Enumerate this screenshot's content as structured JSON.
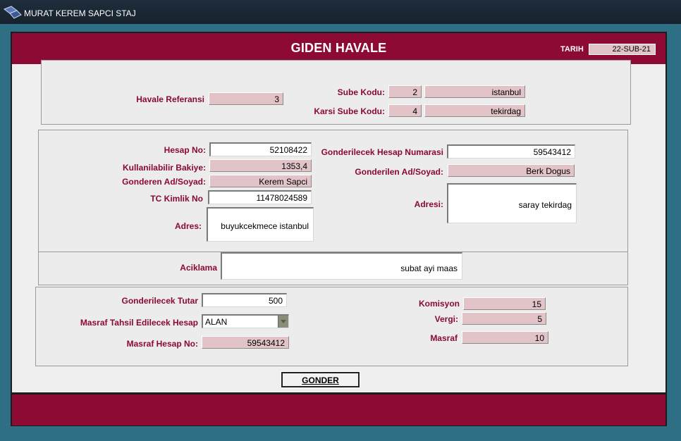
{
  "window": {
    "title": "MURAT KEREM SAPCI STAJ"
  },
  "header": {
    "title": "GIDEN HAVALE",
    "date_label": "TARIH",
    "date_value": "22-SUB-21"
  },
  "reference": {
    "havale_referansi_label": "Havale Referansi",
    "havale_referansi_value": "3",
    "sube_kodu_label": "Sube Kodu:",
    "sube_kodu_value": "2",
    "sube_adi_value": "istanbul",
    "karsi_sube_kodu_label": "Karsi Sube Kodu:",
    "karsi_sube_kodu_value": "4",
    "karsi_sube_adi_value": "tekirdag"
  },
  "sender": {
    "hesap_no_label": "Hesap No:",
    "hesap_no_value": "52108422",
    "bakiye_label": "Kullanilabilir Bakiye:",
    "bakiye_value": "1353,4",
    "ad_soyad_label": "Gonderen Ad/Soyad:",
    "ad_soyad_value": "Kerem Sapci",
    "tc_label": "TC Kimlik No",
    "tc_value": "11478024589",
    "adres_label": "Adres:",
    "adres_value": "buyukcekmece istanbul"
  },
  "receiver": {
    "hesap_label": "Gonderilecek Hesap Numarasi",
    "hesap_value": "59543412",
    "ad_soyad_label": "Gonderilen Ad/Soyad:",
    "ad_soyad_value": "Berk Dogus",
    "adres_label": "Adresi:",
    "adres_value": "saray tekirdag"
  },
  "description": {
    "label": "Aciklama",
    "value": "subat ayi maas"
  },
  "payment": {
    "tutar_label": "Gonderilecek Tutar",
    "tutar_value": "500",
    "masraf_hesap_label": "Masraf Tahsil Edilecek Hesap",
    "masraf_hesap_selected": "ALAN",
    "masraf_hesap_no_label": "Masraf Hesap No:",
    "masraf_hesap_no_value": "59543412",
    "komisyon_label": "Komisyon",
    "komisyon_value": "15",
    "vergi_label": "Vergi:",
    "vergi_value": "5",
    "masraf_label": "Masraf",
    "masraf_value": "10"
  },
  "actions": {
    "send_label": "GONDER"
  },
  "colors": {
    "header": "#8d0a34",
    "label": "#8b0a30",
    "readonly_field": "#e2c3c7",
    "titlebar": "#1f2d3c"
  }
}
